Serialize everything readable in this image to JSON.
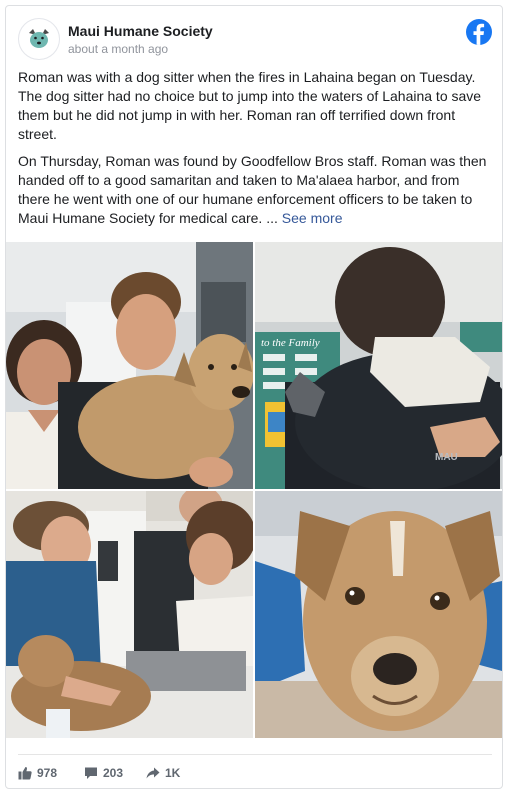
{
  "post": {
    "page_name": "Maui Humane Society",
    "timestamp": "about a month ago",
    "paragraph_1": "Roman was with a dog sitter when the fires in Lahaina began on Tuesday. The dog sitter had no choice but to jump into the waters of Lahaina to save them but he did not jump in with her. Roman ran off terrified down front street.",
    "paragraph_2": "On Thursday, Roman was found by Goodfellow Bros staff. Roman was then handed off to a good samaritan and taken to Ma'alaea harbor, and from there he went with one of our humane enforcement officers to be taken to Maui Humane Society for medical care. ...",
    "see_more": "See more"
  },
  "photos": {
    "sign_text": "to the Family",
    "shirt_text": "MAU"
  },
  "footer": {
    "likes": "978",
    "comments": "203",
    "shares": "1K"
  },
  "icons": {
    "brand": "facebook-logo-icon",
    "like": "thumbs-up-icon",
    "comment": "speech-bubble-icon",
    "share": "share-arrow-icon"
  },
  "colors": {
    "facebook_blue": "#1877f2",
    "link": "#365899",
    "muted": "#90949c"
  }
}
